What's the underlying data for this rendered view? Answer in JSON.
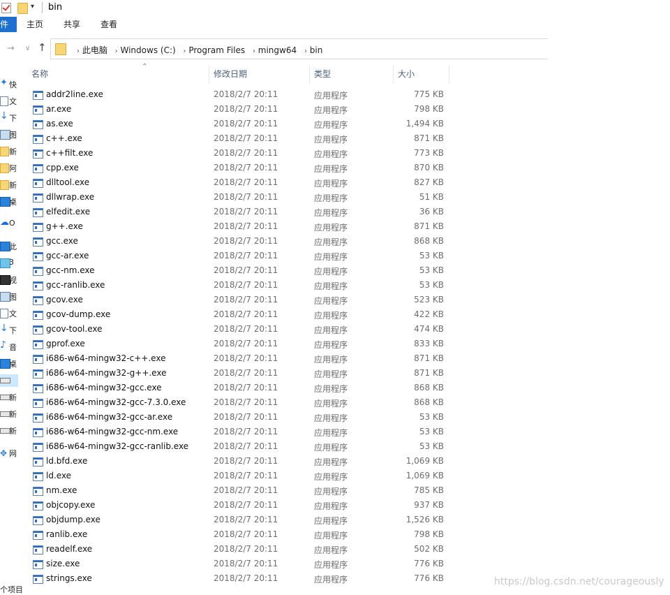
{
  "window": {
    "title": "bin"
  },
  "ribbon": {
    "file_tab": "件",
    "tabs": [
      "主页",
      "共享",
      "查看"
    ]
  },
  "address": {
    "breadcrumbs": [
      "此电脑",
      "Windows (C:)",
      "Program Files",
      "mingw64",
      "bin"
    ]
  },
  "left_nav": {
    "items": [
      {
        "icon": "star-icon",
        "label": "快"
      },
      {
        "icon": "document-icon",
        "label": "文"
      },
      {
        "icon": "download-icon",
        "label": "下"
      },
      {
        "icon": "picture-icon",
        "label": "图"
      },
      {
        "icon": "folder-icon",
        "label": "新"
      },
      {
        "icon": "folder-icon",
        "label": "阿"
      },
      {
        "icon": "folder-icon",
        "label": "新"
      },
      {
        "icon": "monitor-icon",
        "label": "桌"
      },
      {
        "icon": "cloud-icon",
        "label": "O"
      },
      {
        "icon": "computer-icon",
        "label": "此"
      },
      {
        "icon": "3d-objects-icon",
        "label": "3"
      },
      {
        "icon": "video-icon",
        "label": "视"
      },
      {
        "icon": "picture-icon",
        "label": "图"
      },
      {
        "icon": "document-icon",
        "label": "文"
      },
      {
        "icon": "download-icon",
        "label": "下"
      },
      {
        "icon": "music-icon",
        "label": "音"
      },
      {
        "icon": "monitor-icon",
        "label": "桌"
      },
      {
        "icon": "drive-icon",
        "label": ""
      },
      {
        "icon": "drive-icon",
        "label": "新"
      },
      {
        "icon": "drive-icon",
        "label": "新"
      },
      {
        "icon": "drive-icon",
        "label": "新"
      },
      {
        "icon": "network-icon",
        "label": "网"
      }
    ],
    "status": "个项目"
  },
  "columns": {
    "name": "名称",
    "date": "修改日期",
    "type": "类型",
    "size": "大小"
  },
  "files": [
    {
      "name": "addr2line.exe",
      "date": "2018/2/7 20:11",
      "type": "应用程序",
      "size": "775 KB"
    },
    {
      "name": "ar.exe",
      "date": "2018/2/7 20:11",
      "type": "应用程序",
      "size": "798 KB"
    },
    {
      "name": "as.exe",
      "date": "2018/2/7 20:11",
      "type": "应用程序",
      "size": "1,494 KB"
    },
    {
      "name": "c++.exe",
      "date": "2018/2/7 20:11",
      "type": "应用程序",
      "size": "871 KB"
    },
    {
      "name": "c++filt.exe",
      "date": "2018/2/7 20:11",
      "type": "应用程序",
      "size": "773 KB"
    },
    {
      "name": "cpp.exe",
      "date": "2018/2/7 20:11",
      "type": "应用程序",
      "size": "870 KB"
    },
    {
      "name": "dlltool.exe",
      "date": "2018/2/7 20:11",
      "type": "应用程序",
      "size": "827 KB"
    },
    {
      "name": "dllwrap.exe",
      "date": "2018/2/7 20:11",
      "type": "应用程序",
      "size": "51 KB"
    },
    {
      "name": "elfedit.exe",
      "date": "2018/2/7 20:11",
      "type": "应用程序",
      "size": "36 KB"
    },
    {
      "name": "g++.exe",
      "date": "2018/2/7 20:11",
      "type": "应用程序",
      "size": "871 KB"
    },
    {
      "name": "gcc.exe",
      "date": "2018/2/7 20:11",
      "type": "应用程序",
      "size": "868 KB"
    },
    {
      "name": "gcc-ar.exe",
      "date": "2018/2/7 20:11",
      "type": "应用程序",
      "size": "53 KB"
    },
    {
      "name": "gcc-nm.exe",
      "date": "2018/2/7 20:11",
      "type": "应用程序",
      "size": "53 KB"
    },
    {
      "name": "gcc-ranlib.exe",
      "date": "2018/2/7 20:11",
      "type": "应用程序",
      "size": "53 KB"
    },
    {
      "name": "gcov.exe",
      "date": "2018/2/7 20:11",
      "type": "应用程序",
      "size": "523 KB"
    },
    {
      "name": "gcov-dump.exe",
      "date": "2018/2/7 20:11",
      "type": "应用程序",
      "size": "422 KB"
    },
    {
      "name": "gcov-tool.exe",
      "date": "2018/2/7 20:11",
      "type": "应用程序",
      "size": "474 KB"
    },
    {
      "name": "gprof.exe",
      "date": "2018/2/7 20:11",
      "type": "应用程序",
      "size": "833 KB"
    },
    {
      "name": "i686-w64-mingw32-c++.exe",
      "date": "2018/2/7 20:11",
      "type": "应用程序",
      "size": "871 KB"
    },
    {
      "name": "i686-w64-mingw32-g++.exe",
      "date": "2018/2/7 20:11",
      "type": "应用程序",
      "size": "871 KB"
    },
    {
      "name": "i686-w64-mingw32-gcc.exe",
      "date": "2018/2/7 20:11",
      "type": "应用程序",
      "size": "868 KB"
    },
    {
      "name": "i686-w64-mingw32-gcc-7.3.0.exe",
      "date": "2018/2/7 20:11",
      "type": "应用程序",
      "size": "868 KB"
    },
    {
      "name": "i686-w64-mingw32-gcc-ar.exe",
      "date": "2018/2/7 20:11",
      "type": "应用程序",
      "size": "53 KB"
    },
    {
      "name": "i686-w64-mingw32-gcc-nm.exe",
      "date": "2018/2/7 20:11",
      "type": "应用程序",
      "size": "53 KB"
    },
    {
      "name": "i686-w64-mingw32-gcc-ranlib.exe",
      "date": "2018/2/7 20:11",
      "type": "应用程序",
      "size": "53 KB"
    },
    {
      "name": "ld.bfd.exe",
      "date": "2018/2/7 20:11",
      "type": "应用程序",
      "size": "1,069 KB"
    },
    {
      "name": "ld.exe",
      "date": "2018/2/7 20:11",
      "type": "应用程序",
      "size": "1,069 KB"
    },
    {
      "name": "nm.exe",
      "date": "2018/2/7 20:11",
      "type": "应用程序",
      "size": "785 KB"
    },
    {
      "name": "objcopy.exe",
      "date": "2018/2/7 20:11",
      "type": "应用程序",
      "size": "937 KB"
    },
    {
      "name": "objdump.exe",
      "date": "2018/2/7 20:11",
      "type": "应用程序",
      "size": "1,526 KB"
    },
    {
      "name": "ranlib.exe",
      "date": "2018/2/7 20:11",
      "type": "应用程序",
      "size": "798 KB"
    },
    {
      "name": "readelf.exe",
      "date": "2018/2/7 20:11",
      "type": "应用程序",
      "size": "502 KB"
    },
    {
      "name": "size.exe",
      "date": "2018/2/7 20:11",
      "type": "应用程序",
      "size": "776 KB"
    },
    {
      "name": "strings.exe",
      "date": "2018/2/7 20:11",
      "type": "应用程序",
      "size": "776 KB"
    }
  ],
  "watermark": "https://blog.csdn.net/courageously"
}
